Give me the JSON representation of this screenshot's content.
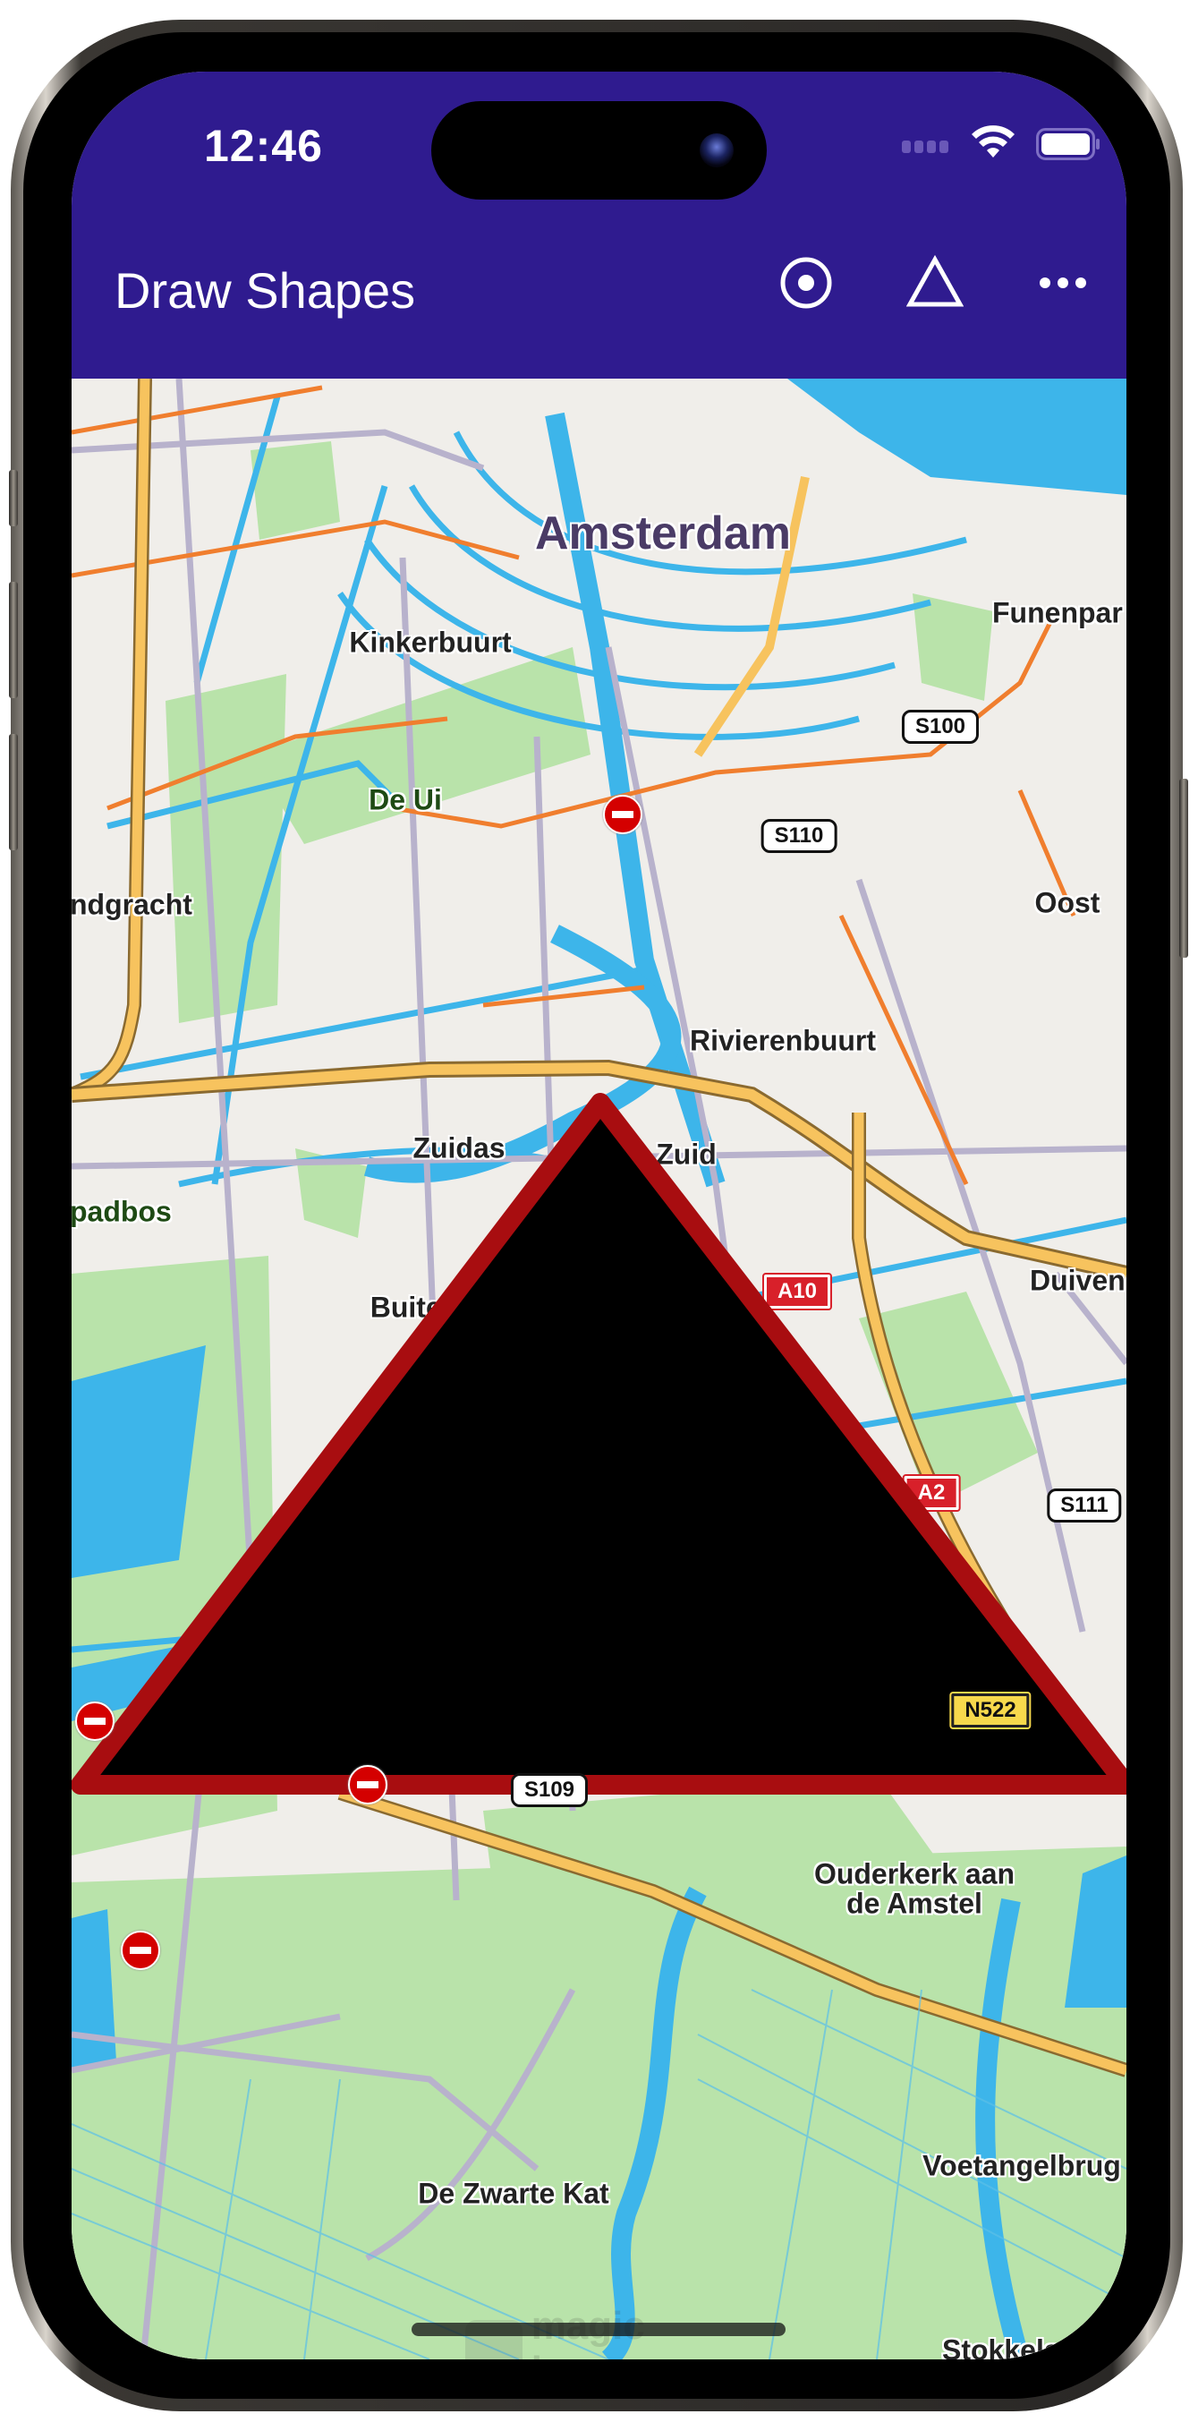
{
  "status_bar": {
    "time": "12:46",
    "icons": [
      "cellular-signal-icon",
      "wifi-icon",
      "battery-icon"
    ]
  },
  "app_bar": {
    "title": "Draw Shapes",
    "background_color": "#2f1b8f",
    "actions": [
      {
        "name": "draw-circle-button",
        "icon": "circle-dot-icon"
      },
      {
        "name": "draw-triangle-button",
        "icon": "triangle-icon"
      },
      {
        "name": "more-options-button",
        "icon": "more-horizontal-icon"
      }
    ]
  },
  "map": {
    "city_label": "Amsterdam",
    "area_labels": [
      {
        "text": "Kinkerbuurt"
      },
      {
        "text": "Funenpar"
      },
      {
        "text": "ndgracht"
      },
      {
        "text": "Oost"
      },
      {
        "text": "Rivierenbuurt"
      },
      {
        "text": "Zuidas"
      },
      {
        "text": "Zuid"
      },
      {
        "text": "Buitenveldert"
      },
      {
        "text": "Duiven"
      },
      {
        "text": "Ouderkerk aan"
      },
      {
        "text": "de Amstel"
      },
      {
        "text": "De Zwarte Kat"
      },
      {
        "text": "Voetangelbrug"
      },
      {
        "text": "Stokkelaarsb"
      }
    ],
    "park_labels": [
      {
        "text": "De Ui"
      },
      {
        "text": "padbos"
      }
    ],
    "road_badges": [
      {
        "text": "S100",
        "style": "white"
      },
      {
        "text": "S110",
        "style": "white"
      },
      {
        "text": "A10",
        "style": "red"
      },
      {
        "text": "A2",
        "style": "red"
      },
      {
        "text": "S111",
        "style": "white"
      },
      {
        "text": "N522",
        "style": "yellow"
      },
      {
        "text": "S109",
        "style": "white"
      }
    ],
    "watermark": "magic lane",
    "colors": {
      "land": "#f0eeea",
      "water": "#3db5ea",
      "park": "#b9e3aa",
      "road_primary": "#f07e2e",
      "highway": "#f7c35e",
      "road_secondary": "#b8b2cc"
    }
  },
  "drawn_shape": {
    "type": "triangle",
    "fill_color": "#000000",
    "stroke_color": "#a80d10"
  }
}
